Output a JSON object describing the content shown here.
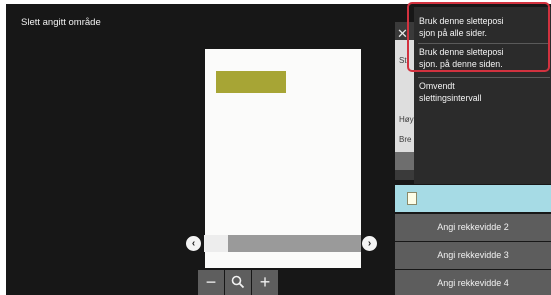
{
  "screen": {
    "title": "Slett angitt område"
  },
  "scroll": {
    "left_icon": "chevron-left-icon",
    "right_icon": "chevron-right-icon",
    "left_glyph": "‹",
    "right_glyph": "›"
  },
  "zoom": {
    "minus_label": "−",
    "plus_label": "+",
    "search_icon": "magnifier-icon"
  },
  "panel": {
    "close_glyph": "✕",
    "label_top": "St",
    "label_height": "Høy",
    "label_width": "Bre"
  },
  "ranges": [
    {
      "label": "Angi rekkevidde 2"
    },
    {
      "label": "Angi rekkevidde 3"
    },
    {
      "label": "Angi rekkevidde 4"
    }
  ],
  "menu": {
    "items": [
      {
        "line1": "Bruk denne sletteposi",
        "line2": "sjon på alle sider."
      },
      {
        "line1": "Bruk denne sletteposi",
        "line2": "sjon. på denne siden."
      },
      {
        "line1": "Omvendt",
        "line2": "slettingsintervall"
      }
    ]
  },
  "colors": {
    "highlight": "#d2323f",
    "selected_row": "#a6dbe5",
    "erase_area": "#a7a535"
  }
}
